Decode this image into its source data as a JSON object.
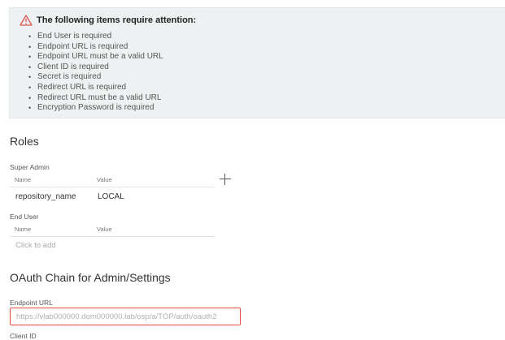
{
  "alert": {
    "title": "The following items require attention:",
    "icon": "warning-triangle-icon",
    "color": "#d9534f",
    "items": [
      "End User is required",
      "Endpoint URL is required",
      "Endpoint URL must be a valid URL",
      "Client ID is required",
      "Secret is required",
      "Redirect URL is required",
      "Redirect URL must be a valid URL",
      "Encryption Password is required"
    ]
  },
  "roles": {
    "title": "Roles",
    "add_icon": "plus-icon",
    "super_admin": {
      "label": "Super Admin",
      "col_name": "Name",
      "col_value": "Value",
      "rows": [
        {
          "name": "repository_name",
          "value": "LOCAL"
        }
      ]
    },
    "end_user": {
      "label": "End User",
      "col_name": "Name",
      "col_value": "Value",
      "empty_text": "Click to add"
    }
  },
  "oauth": {
    "title": "OAuth Chain for Admin/Settings",
    "endpoint_label": "Endpoint URL",
    "endpoint_placeholder": "https://vlab000000.dom000000.lab/osp/a/TOP/auth/oauth2",
    "endpoint_value": "",
    "error_color": "#e74c3c",
    "next_label": "Client ID"
  }
}
